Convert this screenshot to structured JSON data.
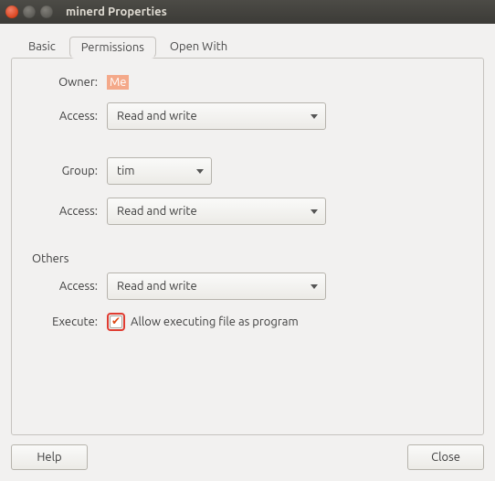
{
  "window": {
    "title": "minerd Properties"
  },
  "tabs": {
    "basic": "Basic",
    "permissions": "Permissions",
    "open_with": "Open With"
  },
  "labels": {
    "owner": "Owner:",
    "access": "Access:",
    "group": "Group:",
    "others": "Others",
    "execute": "Execute:"
  },
  "values": {
    "owner": "Me",
    "owner_access": "Read and write",
    "group": "tim",
    "group_access": "Read and write",
    "others_access": "Read and write",
    "execute_label": "Allow executing file as program",
    "execute_checked": true
  },
  "buttons": {
    "help": "Help",
    "close": "Close"
  }
}
